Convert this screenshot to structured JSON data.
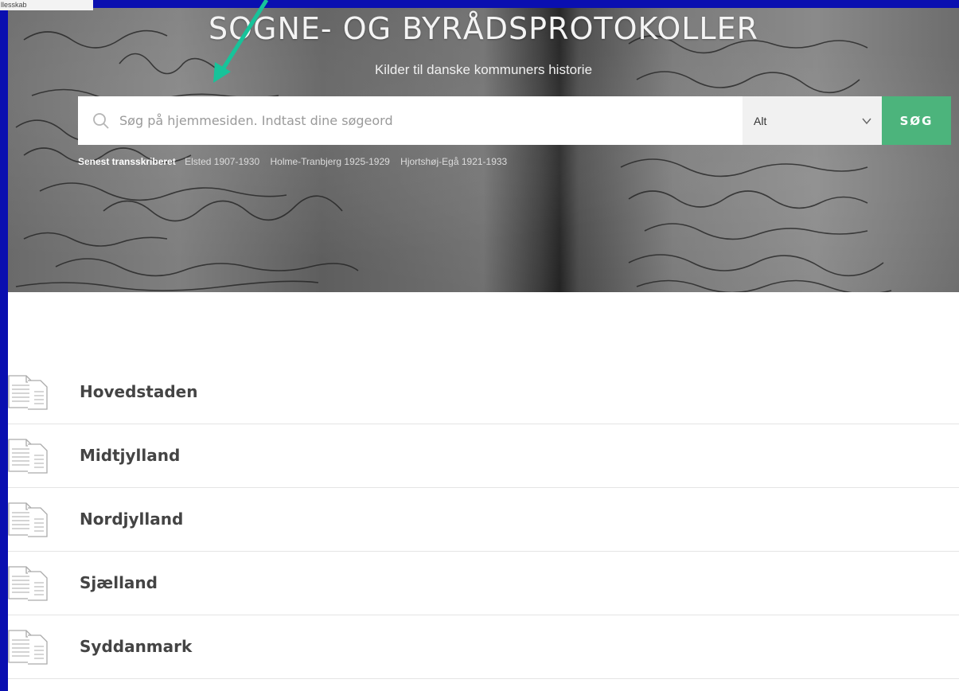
{
  "corner_logo_text": "llesskab",
  "hero": {
    "title": "SOGNE- OG BYRÅDSPROTOKOLLER",
    "subtitle": "Kilder til danske kommuners historie"
  },
  "search": {
    "placeholder": "Søg på hjemmesiden. Indtast dine søgeord",
    "scope_value": "Alt",
    "button_label": "SØG"
  },
  "recent": {
    "label": "Senest transskriberet",
    "items": [
      "Elsted 1907-1930",
      "Holme-Tranbjerg 1925-1929",
      "Hjortshøj-Egå 1921-1933"
    ]
  },
  "regions": [
    "Hovedstaden",
    "Midtjylland",
    "Nordjylland",
    "Sjælland",
    "Syddanmark"
  ],
  "colors": {
    "frame": "#0a0fb0",
    "accent": "#4cb47c",
    "arrow": "#17c39a"
  },
  "icons": {
    "search": "search-icon",
    "dropdown": "chevron-down-icon",
    "region": "document-icon"
  }
}
